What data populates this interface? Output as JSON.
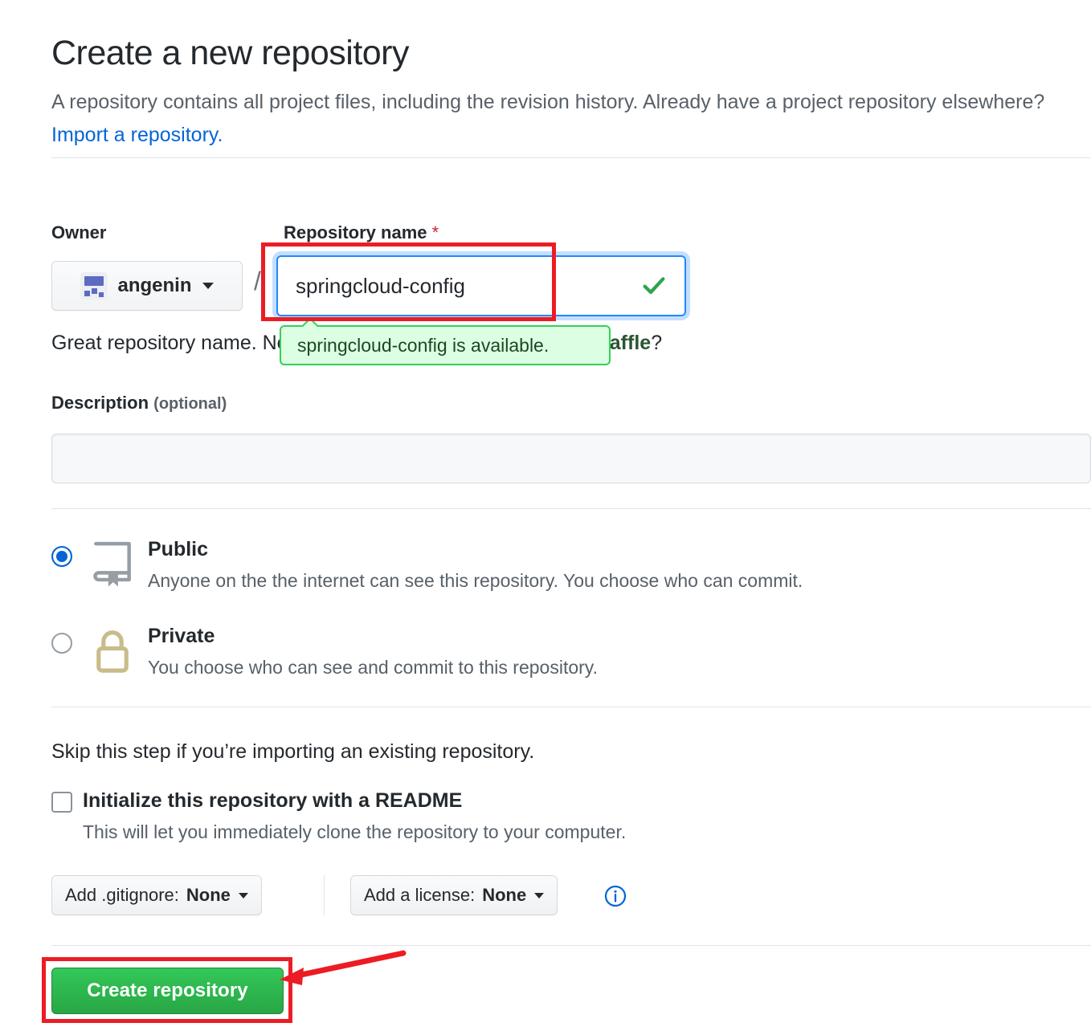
{
  "header": {
    "title": "Create a new repository",
    "description_part1": "A repository contains all project files, including the revision history. Already have a project repository elsewhere? ",
    "import_link": "Import a repository."
  },
  "owner": {
    "label": "Owner",
    "name": "angenin",
    "avatar_icon": "identicon-avatar",
    "caret_icon": "chevron-down-icon"
  },
  "separator": "/",
  "repo_name": {
    "label": "Repository name",
    "required_marker": "*",
    "value": "springcloud-config",
    "placeholder": "",
    "valid_icon": "check-icon",
    "availability_tooltip": "springcloud-config is available.",
    "hint_prefix": "Great repository name. Need inspiration? How about ",
    "hint_suggestion": "sturdy-waffle",
    "hint_suffix": "?"
  },
  "description": {
    "label": "Description",
    "optional_label": "(optional)",
    "value": "",
    "placeholder": ""
  },
  "visibility": {
    "options": [
      {
        "id": "public",
        "title": "Public",
        "description": "Anyone on the the internet can see this repository. You choose who can commit.",
        "icon": "repo-book-icon",
        "selected": true
      },
      {
        "id": "private",
        "title": "Private",
        "description": "You choose who can see and commit to this repository.",
        "icon": "lock-icon",
        "selected": false
      }
    ]
  },
  "initialize": {
    "skip_text": "Skip this step if you’re importing an existing repository.",
    "readme_label": "Initialize this repository with a README",
    "readme_description": "This will let you immediately clone the repository to your computer.",
    "readme_checked": false,
    "gitignore": {
      "prefix": "Add .gitignore:",
      "value": "None"
    },
    "license": {
      "prefix": "Add a license:",
      "value": "None"
    },
    "info_icon": "info-circle-icon"
  },
  "submit": {
    "label": "Create repository"
  },
  "annotations": {
    "highlight_color": "#ec1c24",
    "arrow_icon": "red-arrow-pointing-left"
  },
  "colors": {
    "link": "#0366d6",
    "focus_border": "#2188ff",
    "available_bg": "#dcffe4",
    "available_border": "#34d058",
    "suggestion_green": "#28562f",
    "primary_button": "#28a745",
    "required_red": "#cb2431",
    "lock_icon": "#c8bc8a",
    "repo_icon": "#959da5"
  }
}
